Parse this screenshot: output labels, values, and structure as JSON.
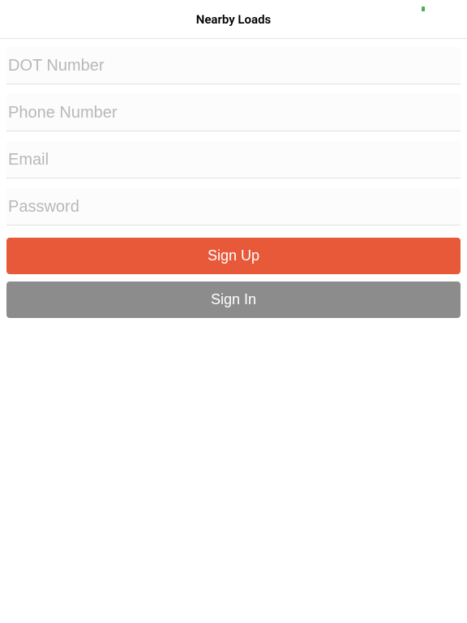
{
  "header": {
    "title": "Nearby Loads"
  },
  "form": {
    "dot_placeholder": "DOT Number",
    "phone_placeholder": "Phone Number",
    "email_placeholder": "Email",
    "password_placeholder": "Password",
    "signup_label": "Sign Up",
    "signin_label": "Sign In"
  }
}
